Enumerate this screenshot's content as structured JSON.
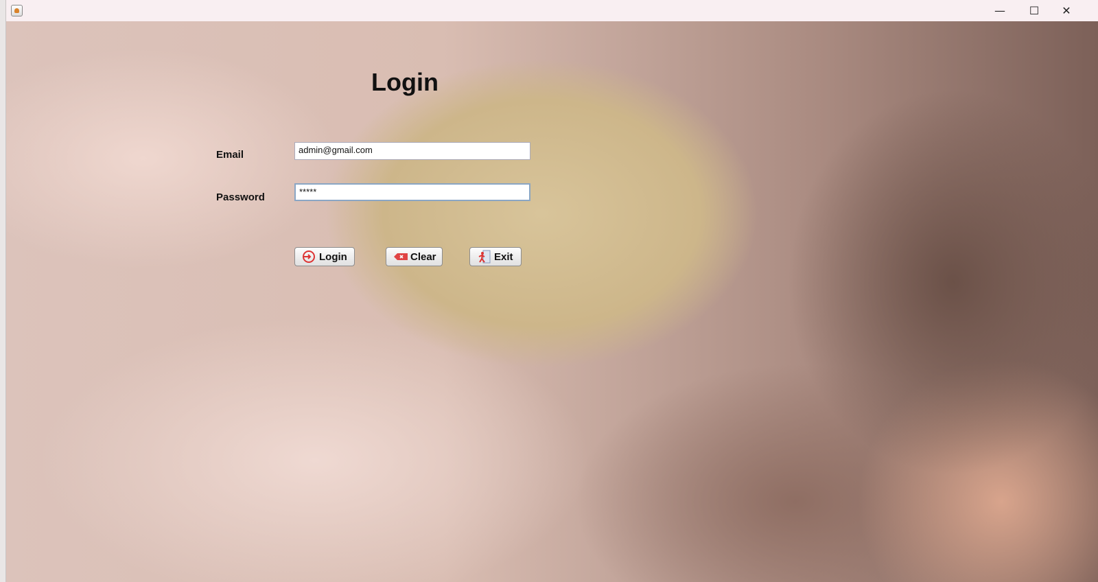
{
  "window": {
    "controls": {
      "minimize": "—",
      "maximize": "☐",
      "close": "✕"
    }
  },
  "login": {
    "title": "Login",
    "email_label": "Email",
    "email_value": "admin@gmail.com",
    "password_label": "Password",
    "password_value": "*****",
    "buttons": {
      "login": "Login",
      "clear": "Clear",
      "exit": "Exit"
    }
  }
}
